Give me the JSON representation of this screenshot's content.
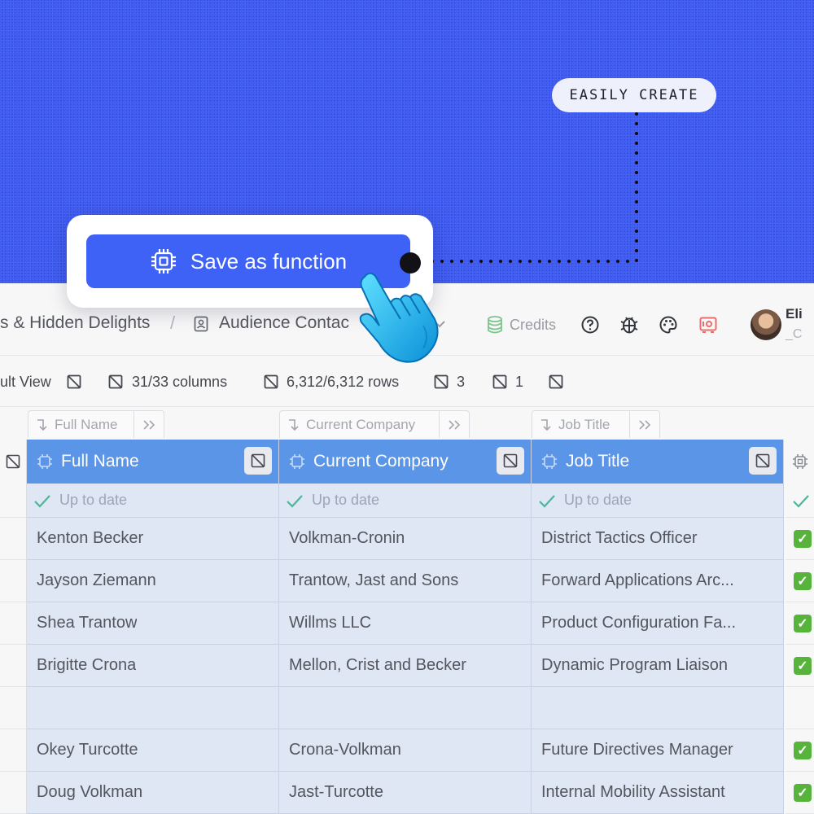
{
  "hero": {
    "pill_text": "EASILY CREATE"
  },
  "popup": {
    "save_label": "Save as function",
    "icon": "cpu-chip-icon"
  },
  "topbar": {
    "breadcrumb_1": "s & Hidden Delights",
    "breadcrumb_sep": "/",
    "breadcrumb_2": "Audience Contac",
    "credits_label": "Credits",
    "user_name": "Eli",
    "user_sub": "_C"
  },
  "toolbar": {
    "view_label": "ult View",
    "columns_label": "31/33 columns",
    "rows_label": "6,312/6,312 rows",
    "filter_count": "3",
    "sort_count": "1"
  },
  "columns": [
    {
      "source_label": "Full Name",
      "title": "Full Name",
      "status": "Up to date"
    },
    {
      "source_label": "Current Company",
      "title": "Current Company",
      "status": "Up to date"
    },
    {
      "source_label": "Job Title",
      "title": "Job Title",
      "status": "Up to date"
    }
  ],
  "rows": [
    {
      "name": "Kenton Becker",
      "company": "Volkman-Cronin",
      "title": "District Tactics Officer",
      "checked": true
    },
    {
      "name": "Jayson Ziemann",
      "company": "Trantow, Jast and Sons",
      "title": "Forward Applications Arc...",
      "checked": true
    },
    {
      "name": "Shea Trantow",
      "company": "Willms LLC",
      "title": "Product Configuration Fa...",
      "checked": true
    },
    {
      "name": "Brigitte Crona",
      "company": "Mellon, Crist and Becker",
      "title": "Dynamic Program Liaison",
      "checked": true
    },
    {
      "name": "",
      "company": "",
      "title": "",
      "checked": false
    },
    {
      "name": "Okey Turcotte",
      "company": "Crona-Volkman",
      "title": "Future Directives Manager",
      "checked": true
    },
    {
      "name": "Doug Volkman",
      "company": "Jast-Turcotte",
      "title": "Internal Mobility Assistant",
      "checked": true
    }
  ],
  "colors": {
    "hero_blue": "#3a58f4",
    "button_blue": "#3d62f5",
    "header_blue": "#5b95e8",
    "cell_bg": "#dfe6f4",
    "check_green": "#58b33c"
  }
}
